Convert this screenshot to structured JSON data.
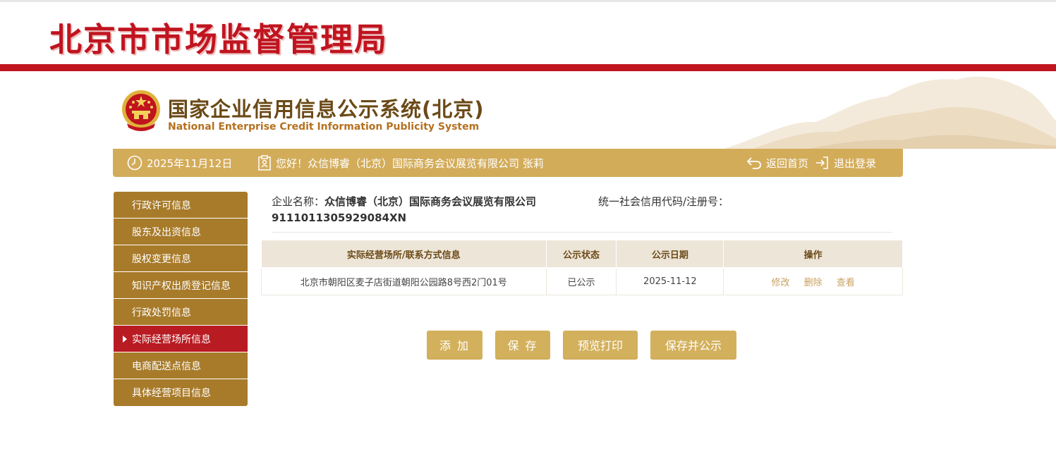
{
  "header": {
    "bureau_title": "北京市市场监督管理局",
    "system_title": "国家企业信用信息公示系统(北京)",
    "system_subtitle": "National Enterprise Credit Information Publicity System"
  },
  "info_bar": {
    "date": "2025年11月12日",
    "greeting": "您好！众信博睿（北京）国际商务会议展览有限公司 张莉",
    "home_link": "返回首页",
    "logout_link": "退出登录"
  },
  "sidebar": {
    "items": [
      {
        "label": "行政许可信息"
      },
      {
        "label": "股东及出资信息"
      },
      {
        "label": "股权变更信息"
      },
      {
        "label": "知识产权出质登记信息"
      },
      {
        "label": "行政处罚信息"
      },
      {
        "label": "实际经营场所信息"
      },
      {
        "label": "电商配送点信息"
      },
      {
        "label": "具体经营项目信息"
      }
    ],
    "active_index": 5
  },
  "company": {
    "name_label": "企业名称：",
    "name": "众信博睿（北京）国际商务会议展览有限公司",
    "code_label": "统一社会信用代码/注册号：",
    "code": "9111011305929084XN"
  },
  "table": {
    "headers": [
      "实际经营场所/联系方式信息",
      "公示状态",
      "公示日期",
      "操作"
    ],
    "rows": [
      {
        "address": "北京市朝阳区麦子店街道朝阳公园路8号西2门01号",
        "status": "已公示",
        "date": "2025-11-12",
        "actions": [
          "修改",
          "删除",
          "查看"
        ]
      }
    ]
  },
  "buttons": {
    "add": "添 加",
    "save": "保 存",
    "preview": "预览打印",
    "save_publish": "保存并公示"
  },
  "colors": {
    "brand_red": "#c0141f",
    "gold": "#d3ac5a",
    "sidebar_brown": "#a87b2a",
    "active_red": "#b81b22"
  }
}
